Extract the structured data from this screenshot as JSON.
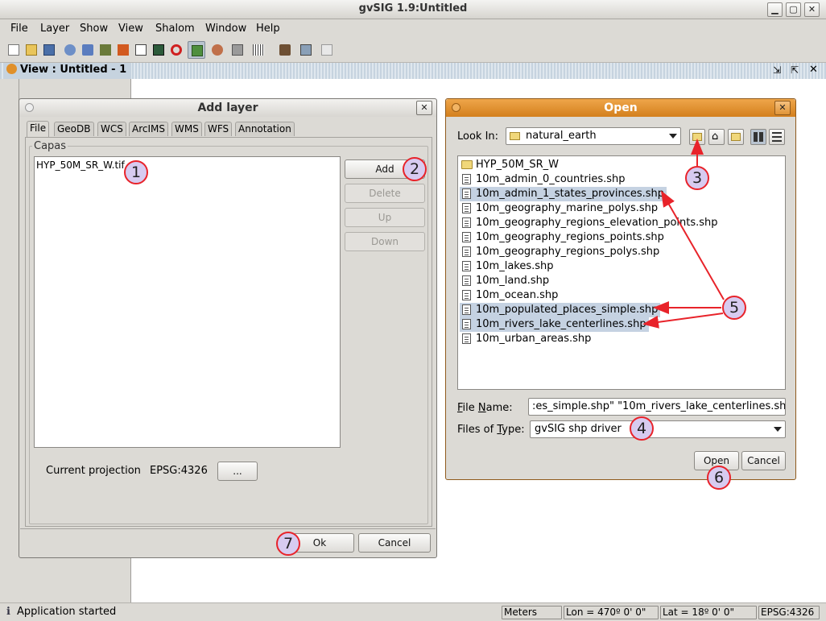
{
  "app": {
    "title": "gvSIG 1.9:Untitled"
  },
  "menu": [
    "File",
    "Layer",
    "Show",
    "View",
    "Shalom",
    "Window",
    "Help"
  ],
  "view_window": {
    "title": "View : Untitled - 1"
  },
  "add_layer": {
    "title": "Add layer",
    "tabs": [
      "File",
      "GeoDB",
      "WCS",
      "ArcIMS",
      "WMS",
      "WFS",
      "Annotation"
    ],
    "group_label": "Capas",
    "layers": [
      "HYP_50M_SR_W.tif"
    ],
    "buttons": {
      "add": "Add",
      "delete": "Delete",
      "up": "Up",
      "down": "Down"
    },
    "projection_label": "Current projection",
    "projection_value": "EPSG:4326",
    "projection_button": "...",
    "ok": "Ok",
    "cancel": "Cancel"
  },
  "open_dialog": {
    "title": "Open",
    "look_in_label": "Look In:",
    "look_in_value": "natural_earth",
    "files": [
      {
        "name": "HYP_50M_SR_W",
        "kind": "folder",
        "selected": false
      },
      {
        "name": "10m_admin_0_countries.shp",
        "kind": "file",
        "selected": false
      },
      {
        "name": "10m_admin_1_states_provinces.shp",
        "kind": "file",
        "selected": true
      },
      {
        "name": "10m_geography_marine_polys.shp",
        "kind": "file",
        "selected": false
      },
      {
        "name": "10m_geography_regions_elevation_points.shp",
        "kind": "file",
        "selected": false
      },
      {
        "name": "10m_geography_regions_points.shp",
        "kind": "file",
        "selected": false
      },
      {
        "name": "10m_geography_regions_polys.shp",
        "kind": "file",
        "selected": false
      },
      {
        "name": "10m_lakes.shp",
        "kind": "file",
        "selected": false
      },
      {
        "name": "10m_land.shp",
        "kind": "file",
        "selected": false
      },
      {
        "name": "10m_ocean.shp",
        "kind": "file",
        "selected": false
      },
      {
        "name": "10m_populated_places_simple.shp",
        "kind": "file",
        "selected": true
      },
      {
        "name": "10m_rivers_lake_centerlines.shp",
        "kind": "file",
        "selected": true
      },
      {
        "name": "10m_urban_areas.shp",
        "kind": "file",
        "selected": false
      }
    ],
    "file_name_label": "File Name:",
    "file_name_value": ":es_simple.shp\" \"10m_rivers_lake_centerlines.shp\"",
    "files_of_type_label": "Files of Type:",
    "files_of_type_value": "gvSIG shp driver",
    "open": "Open",
    "cancel": "Cancel"
  },
  "annotations": [
    "1",
    "2",
    "3",
    "4",
    "5",
    "6",
    "7"
  ],
  "status": {
    "message": "Application started",
    "units": "Meters",
    "lon": "Lon = 470º 0' 0\"",
    "lat": "Lat = 18º 0' 0\"",
    "crs": "EPSG:4326"
  },
  "colors": {
    "accent_orange": "#e0902a",
    "selection": "#c5d2e2",
    "annotation_red": "#e8232a",
    "annotation_fill": "#d7cbf0"
  }
}
